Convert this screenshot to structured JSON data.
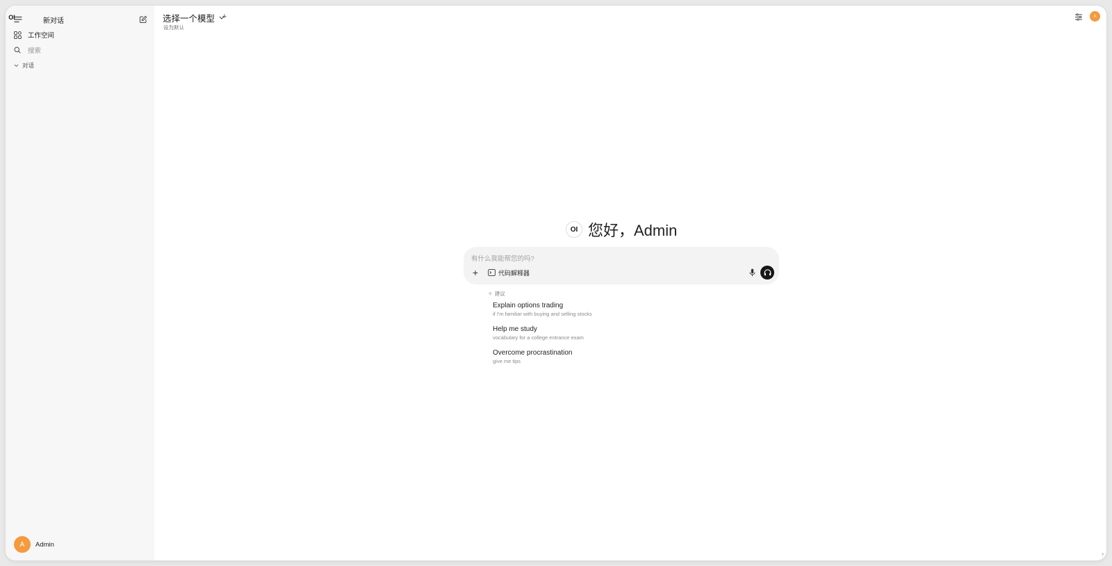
{
  "sidebar": {
    "new_chat_label": "新对话",
    "logo_text": "OI",
    "workspace_label": "工作空间",
    "search_placeholder": "搜索",
    "chats_label": "对话",
    "user": {
      "avatar_initial": "A",
      "name": "Admin"
    }
  },
  "header": {
    "model_selector_label": "选择一个模型",
    "set_default_label": "设为默认",
    "add_label": "+",
    "avatar_initial": "A"
  },
  "greeting": {
    "logo_text": "OI",
    "text": "您好，Admin"
  },
  "composer": {
    "placeholder": "有什么我能帮您的吗?",
    "add_label": "+",
    "code_interpreter_label": "代码解释器"
  },
  "suggestions": {
    "header": "建议",
    "items": [
      {
        "title": "Explain options trading",
        "subtitle": "if I'm familiar with buying and selling stocks"
      },
      {
        "title": "Help me study",
        "subtitle": "vocabulary for a college entrance exam"
      },
      {
        "title": "Overcome procrastination",
        "subtitle": "give me tips"
      }
    ]
  },
  "help_label": "?",
  "colors": {
    "accent": "#f59a3e",
    "sidebar_bg": "#f7f7f7",
    "voice_button": "#171717"
  }
}
